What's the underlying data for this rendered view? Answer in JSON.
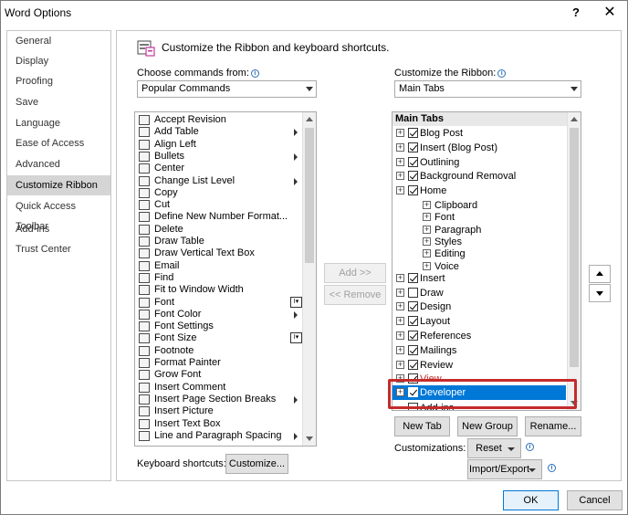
{
  "window": {
    "title": "Word Options",
    "help": "?",
    "close": "✕"
  },
  "nav": {
    "items": [
      "General",
      "Display",
      "Proofing",
      "Save",
      "Language",
      "Ease of Access",
      "Advanced",
      "Customize Ribbon",
      "Quick Access Toolbar",
      "Add-ins",
      "Trust Center"
    ],
    "selected": "Customize Ribbon"
  },
  "header": {
    "title": "Customize the Ribbon and keyboard shortcuts."
  },
  "left": {
    "label": "Choose commands from:",
    "selected": "Popular Commands",
    "commands": [
      {
        "label": "Accept Revision",
        "sub": false,
        "pick": false
      },
      {
        "label": "Add Table",
        "sub": true,
        "pick": false
      },
      {
        "label": "Align Left",
        "sub": false,
        "pick": false
      },
      {
        "label": "Bullets",
        "sub": true,
        "pick": false
      },
      {
        "label": "Center",
        "sub": false,
        "pick": false
      },
      {
        "label": "Change List Level",
        "sub": true,
        "pick": false
      },
      {
        "label": "Copy",
        "sub": false,
        "pick": false
      },
      {
        "label": "Cut",
        "sub": false,
        "pick": false
      },
      {
        "label": "Define New Number Format...",
        "sub": false,
        "pick": false
      },
      {
        "label": "Delete",
        "sub": false,
        "pick": false
      },
      {
        "label": "Draw Table",
        "sub": false,
        "pick": false
      },
      {
        "label": "Draw Vertical Text Box",
        "sub": false,
        "pick": false
      },
      {
        "label": "Email",
        "sub": false,
        "pick": false
      },
      {
        "label": "Find",
        "sub": false,
        "pick": false
      },
      {
        "label": "Fit to Window Width",
        "sub": false,
        "pick": false
      },
      {
        "label": "Font",
        "sub": false,
        "pick": true
      },
      {
        "label": "Font Color",
        "sub": true,
        "pick": false
      },
      {
        "label": "Font Settings",
        "sub": false,
        "pick": false
      },
      {
        "label": "Font Size",
        "sub": false,
        "pick": true
      },
      {
        "label": "Footnote",
        "sub": false,
        "pick": false
      },
      {
        "label": "Format Painter",
        "sub": false,
        "pick": false
      },
      {
        "label": "Grow Font",
        "sub": false,
        "pick": false
      },
      {
        "label": "Insert Comment",
        "sub": false,
        "pick": false
      },
      {
        "label": "Insert Page  Section Breaks",
        "sub": true,
        "pick": false
      },
      {
        "label": "Insert Picture",
        "sub": false,
        "pick": false
      },
      {
        "label": "Insert Text Box",
        "sub": false,
        "pick": false
      },
      {
        "label": "Line and Paragraph Spacing",
        "sub": true,
        "pick": false
      }
    ]
  },
  "middle": {
    "add": "Add >>",
    "remove": "<< Remove"
  },
  "right": {
    "label": "Customize the Ribbon:",
    "selected": "Main Tabs",
    "tree_header": "Main Tabs",
    "tree": [
      {
        "label": "Blog Post",
        "level": 0,
        "checked": true,
        "expander": true,
        "hl": false
      },
      {
        "label": "Insert (Blog Post)",
        "level": 0,
        "checked": true,
        "expander": true,
        "hl": false
      },
      {
        "label": "Outlining",
        "level": 0,
        "checked": true,
        "expander": true,
        "hl": false
      },
      {
        "label": "Background Removal",
        "level": 0,
        "checked": true,
        "expander": true,
        "hl": false
      },
      {
        "label": "Home",
        "level": 0,
        "checked": true,
        "expander": true,
        "hl": false
      },
      {
        "label": "Clipboard",
        "level": 1,
        "checked": false,
        "expander": true,
        "hl": false
      },
      {
        "label": "Font",
        "level": 1,
        "checked": false,
        "expander": true,
        "hl": false
      },
      {
        "label": "Paragraph",
        "level": 1,
        "checked": false,
        "expander": true,
        "hl": false
      },
      {
        "label": "Styles",
        "level": 1,
        "checked": false,
        "expander": true,
        "hl": false
      },
      {
        "label": "Editing",
        "level": 1,
        "checked": false,
        "expander": true,
        "hl": false
      },
      {
        "label": "Voice",
        "level": 1,
        "checked": false,
        "expander": true,
        "hl": false
      },
      {
        "label": "Insert",
        "level": 0,
        "checked": true,
        "expander": true,
        "hl": false
      },
      {
        "label": "Draw",
        "level": 0,
        "checked": false,
        "expander": true,
        "hl": false
      },
      {
        "label": "Design",
        "level": 0,
        "checked": true,
        "expander": true,
        "hl": false
      },
      {
        "label": "Layout",
        "level": 0,
        "checked": true,
        "expander": true,
        "hl": false
      },
      {
        "label": "References",
        "level": 0,
        "checked": true,
        "expander": true,
        "hl": false
      },
      {
        "label": "Mailings",
        "level": 0,
        "checked": true,
        "expander": true,
        "hl": false
      },
      {
        "label": "Review",
        "level": 0,
        "checked": true,
        "expander": true,
        "hl": false
      },
      {
        "label": "View",
        "level": 0,
        "checked": true,
        "expander": true,
        "hl": false
      },
      {
        "label": "Developer",
        "level": 0,
        "checked": true,
        "expander": true,
        "hl": true
      },
      {
        "label": "Add-ins",
        "level": 0,
        "checked": false,
        "expander": false,
        "hl": false
      }
    ],
    "new_tab": "New Tab",
    "new_group": "New Group",
    "rename": "Rename...",
    "customizations_label": "Customizations:",
    "reset": "Reset",
    "import_export": "Import/Export"
  },
  "keyboard": {
    "label": "Keyboard shortcuts:",
    "customize": "Customize..."
  },
  "footer": {
    "ok": "OK",
    "cancel": "Cancel"
  },
  "colors": {
    "selection": "#0078d7",
    "highlight_border": "#c42b2b",
    "nav_selected": "#d5d5d5"
  }
}
